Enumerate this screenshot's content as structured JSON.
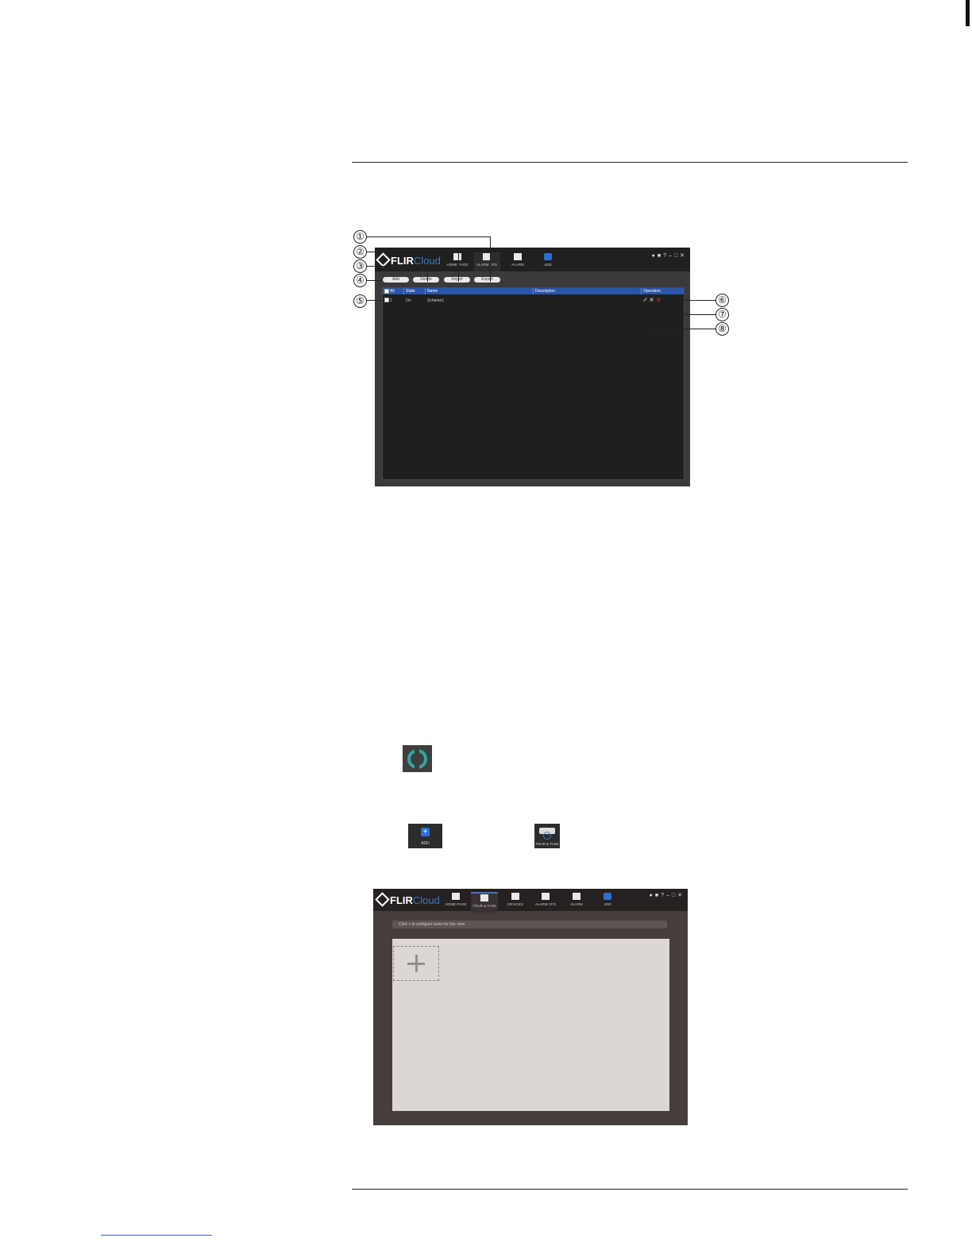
{
  "figure1": {
    "brand": {
      "word": "FLIR",
      "cloud": "Cloud"
    },
    "nav": [
      {
        "label": "HOME PAGE",
        "icon": "home-icon"
      },
      {
        "label": "ALARM CFG",
        "icon": "alarm-cfg-icon",
        "active": true
      },
      {
        "label": "ALARM",
        "icon": "alarm-icon"
      },
      {
        "label": "ADD",
        "icon": "add-icon"
      }
    ],
    "window_controls": [
      "user-icon",
      "lock-icon",
      "help-icon",
      "minimize-icon",
      "maximize-icon",
      "close-icon"
    ],
    "buttons": {
      "add": "Add",
      "delete": "Delete",
      "import": "Import",
      "export": "Export"
    },
    "columns": {
      "all": "All",
      "state": "State",
      "name": "Name",
      "description": "Description",
      "operation": "Operation"
    },
    "rows": [
      {
        "index": "1",
        "state": "On",
        "name": "Scheme1",
        "description": ""
      }
    ],
    "callouts": [
      "①",
      "②",
      "③",
      "④",
      "⑤",
      "⑥",
      "⑦",
      "⑧"
    ]
  },
  "icons": {
    "refresh_color": "#2fa6a0",
    "add_label": "ADD",
    "tour_label": "TOUR & TASK"
  },
  "figure2": {
    "brand": {
      "word": "FLIR",
      "cloud": "Cloud"
    },
    "nav": [
      {
        "label": "HOME PAGE",
        "icon": "home-icon"
      },
      {
        "label": "TOUR & TASK",
        "icon": "tour-task-icon",
        "active": true
      },
      {
        "label": "DEVICES",
        "icon": "devices-icon"
      },
      {
        "label": "ALARM CFG",
        "icon": "alarm-cfg-icon"
      },
      {
        "label": "ALARM",
        "icon": "alarm-icon"
      },
      {
        "label": "ADD",
        "icon": "add-icon"
      }
    ],
    "tip": "Click + to configure tasks for live view."
  },
  "colors": {
    "accent": "#2b6fd6",
    "header_blue": "#2a55a8",
    "teal": "#2fa6a0"
  }
}
